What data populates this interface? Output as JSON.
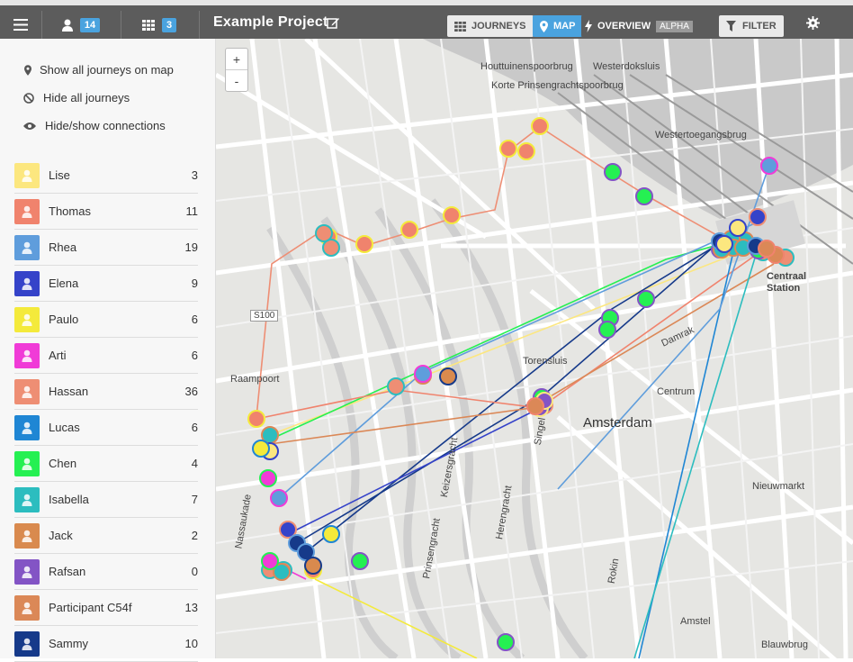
{
  "topbar": {
    "participants_count": "14",
    "groups_count": "3",
    "project_title": "Example Project",
    "tab_journeys": "JOURNEYS",
    "tab_map": "MAP",
    "tab_overview": "OVERVIEW",
    "tab_overview_badge": "ALPHA",
    "filter": "FILTER"
  },
  "sidebar": {
    "actions": {
      "show_all": "Show all journeys on map",
      "hide_all": "Hide all journeys",
      "toggle_connections": "Hide/show connections"
    },
    "participants": [
      {
        "name": "Lise",
        "count": "3",
        "color": "#fce77f"
      },
      {
        "name": "Thomas",
        "count": "11",
        "color": "#f0836d"
      },
      {
        "name": "Rhea",
        "count": "19",
        "color": "#5f9ddc"
      },
      {
        "name": "Elena",
        "count": "9",
        "color": "#3543c9"
      },
      {
        "name": "Paulo",
        "count": "6",
        "color": "#f4ea3b"
      },
      {
        "name": "Arti",
        "count": "6",
        "color": "#f03bd7"
      },
      {
        "name": "Hassan",
        "count": "36",
        "color": "#ee8e74"
      },
      {
        "name": "Lucas",
        "count": "6",
        "color": "#1f86d4"
      },
      {
        "name": "Chen",
        "count": "4",
        "color": "#25f052"
      },
      {
        "name": "Isabella",
        "count": "7",
        "color": "#2cbdbf"
      },
      {
        "name": "Jack",
        "count": "2",
        "color": "#d98a4e"
      },
      {
        "name": "Rafsan",
        "count": "0",
        "color": "#8354c5"
      },
      {
        "name": "Participant C54f",
        "count": "13",
        "color": "#db8857"
      },
      {
        "name": "Sammy",
        "count": "10",
        "color": "#163a8a"
      }
    ]
  },
  "map": {
    "zoom_in": "+",
    "zoom_out": "-",
    "labels": {
      "city": "Amsterdam",
      "centraal": "Centraal",
      "station": "Station",
      "centrum": "Centrum",
      "nieuwmarkt": "Nieuwmarkt",
      "torensluis": "Torensluis",
      "raampoort": "Raampoort",
      "westertoegangsbrug": "Westertoegangsbrug",
      "houttuinen": "Houttuinenspoorbrug",
      "korte": "Korte Prinsengrachtspoorbrug",
      "westerdok": "Westerdoksluis",
      "damrak": "Damrak",
      "amstel": "Amstel",
      "prinsengracht": "Prinsengracht",
      "keizersgracht": "Keizersgracht",
      "herengracht": "Herengracht",
      "singel": "Singel",
      "rokin": "Rokin",
      "nassaukade": "Nassaukade",
      "s100": "S100",
      "blauwbrug": "Blauwbrug"
    }
  }
}
